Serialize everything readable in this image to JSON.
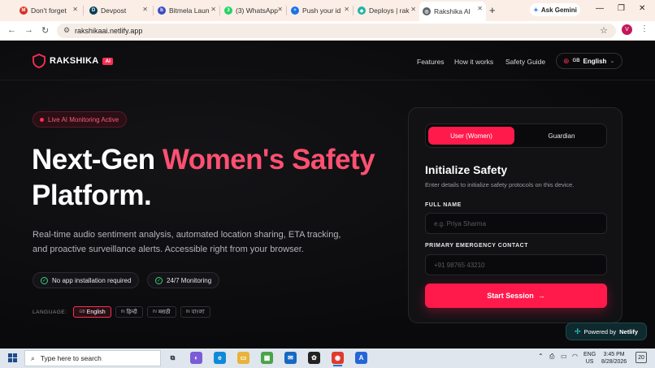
{
  "browser": {
    "tabs": [
      {
        "title": "Don't forget",
        "icon": "gmail-icon",
        "color": "#d93025",
        "glyph": "M"
      },
      {
        "title": "Devpost",
        "icon": "devpost-icon",
        "color": "#003e54",
        "glyph": "D"
      },
      {
        "title": "Bitmela Laun",
        "icon": "bitmela-icon",
        "color": "#3c4cc4",
        "glyph": "b"
      },
      {
        "title": "(3) WhatsApp",
        "icon": "whatsapp-icon",
        "color": "#25d366",
        "glyph": "3"
      },
      {
        "title": "Push your id",
        "icon": "push-icon",
        "color": "#1a73e8",
        "glyph": "+"
      },
      {
        "title": "Deploys | rak",
        "icon": "netlify-icon",
        "color": "#20b3a6",
        "glyph": "◆"
      },
      {
        "title": "Rakshika AI",
        "icon": "globe-icon",
        "color": "#5f6368",
        "glyph": "◎"
      }
    ],
    "ask_gemini": "Ask Gemini",
    "url": "rakshikaai.netlify.app",
    "profile_initial": "V"
  },
  "header": {
    "brand": "RAKSHIKA",
    "brand_badge": "AI",
    "nav": [
      "Features",
      "How it works",
      "Safety Guide"
    ],
    "language": {
      "code": "GB",
      "label": "English"
    }
  },
  "hero": {
    "badge": "Live AI Monitoring Active",
    "title_part1": "Next-Gen ",
    "title_accent": "Women's Safety",
    "title_part2": "Platform.",
    "subtitle": "Real-time audio sentiment analysis, automated location sharing, ETA tracking, and proactive surveillance alerts. Accessible right from your browser.",
    "features": [
      "No app installation required",
      "24/7 Monitoring"
    ],
    "language_label": "LANGUAGE:",
    "languages": [
      {
        "code": "GB",
        "label": "English",
        "selected": true
      },
      {
        "code": "IN",
        "label": "हिन्दी",
        "selected": false
      },
      {
        "code": "IN",
        "label": "मराठी",
        "selected": false
      },
      {
        "code": "IN",
        "label": "বাংলা",
        "selected": false
      }
    ]
  },
  "card": {
    "tabs": [
      "User (Women)",
      "Guardian"
    ],
    "title": "Initialize Safety",
    "description": "Enter details to initialize safety protocols on this device.",
    "full_name_label": "FULL NAME",
    "full_name_placeholder": "e.g. Priya Sharma",
    "contact_label": "PRIMARY EMERGENCY CONTACT",
    "contact_placeholder": "+91 98765 43210",
    "start_button": "Start Session"
  },
  "netlify_badge": {
    "prefix": "Powered by",
    "brand": "Netlify"
  },
  "taskbar": {
    "search_placeholder": "Type here to search",
    "language": "ENG",
    "region": "US",
    "time": "3:45 PM",
    "date": "8/28/2026",
    "notifications": "20"
  },
  "colors": {
    "accent": "#ff1a4b",
    "accent_text": "#ff5071",
    "success": "#3ad17d"
  }
}
